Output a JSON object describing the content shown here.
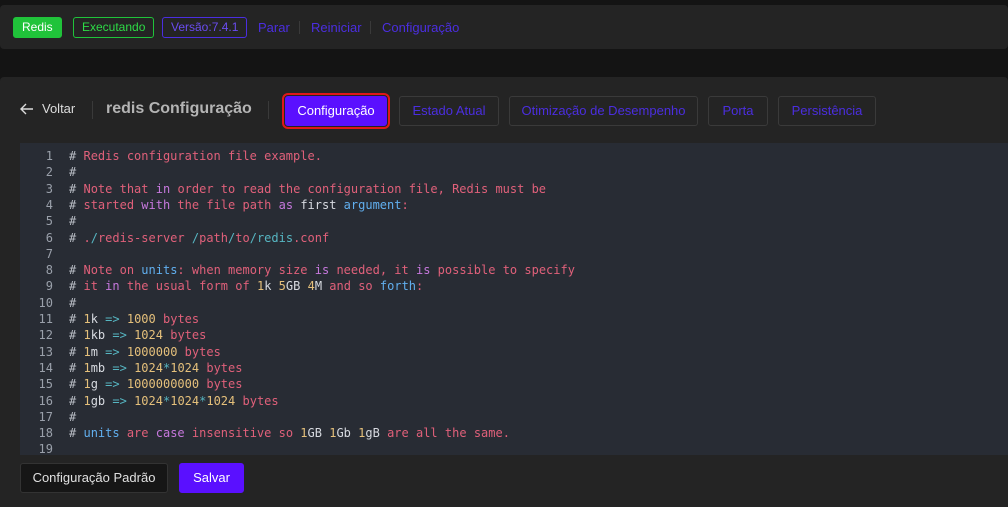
{
  "topbar": {
    "app_badge": "Redis",
    "status_badge": "Executando",
    "version_badge": "Versão:7.4.1",
    "links": [
      "Parar",
      "Reiniciar",
      "Configuração"
    ]
  },
  "header": {
    "back_label": "Voltar",
    "title": "redis Configuração"
  },
  "tabs": [
    {
      "label": "Configuração",
      "active": true
    },
    {
      "label": "Estado Atual",
      "active": false
    },
    {
      "label": "Otimização de Desempenho",
      "active": false
    },
    {
      "label": "Porta",
      "active": false
    },
    {
      "label": "Persistência",
      "active": false
    }
  ],
  "editor": {
    "line_numbers": [
      "1",
      "2",
      "3",
      "4",
      "5",
      "6",
      "7",
      "8",
      "9",
      "10",
      "11",
      "12",
      "13",
      "14",
      "15",
      "16",
      "17",
      "18",
      "19"
    ],
    "lines": [
      "# Redis configuration file example.",
      "#",
      "# Note that in order to read the configuration file, Redis must be",
      "# started with the file path as first argument:",
      "#",
      "# ./redis-server /path/to/redis.conf",
      "",
      "# Note on units: when memory size is needed, it is possible to specify",
      "# it in the usual form of 1k 5GB 4M and so forth:",
      "#",
      "# 1k => 1000 bytes",
      "# 1kb => 1024 bytes",
      "# 1m => 1000000 bytes",
      "# 1mb => 1024*1024 bytes",
      "# 1g => 1000000000 bytes",
      "# 1gb => 1024*1024*1024 bytes",
      "#",
      "# units are case insensitive so 1GB 1Gb 1gB are all the same.",
      ""
    ]
  },
  "footer": {
    "default_button": "Configuração Padrão",
    "save_button": "Salvar"
  },
  "colors": {
    "accent": "#5a10ff",
    "success": "#20c33a",
    "link": "#4b2ee0",
    "highlight_border": "#e01818"
  }
}
